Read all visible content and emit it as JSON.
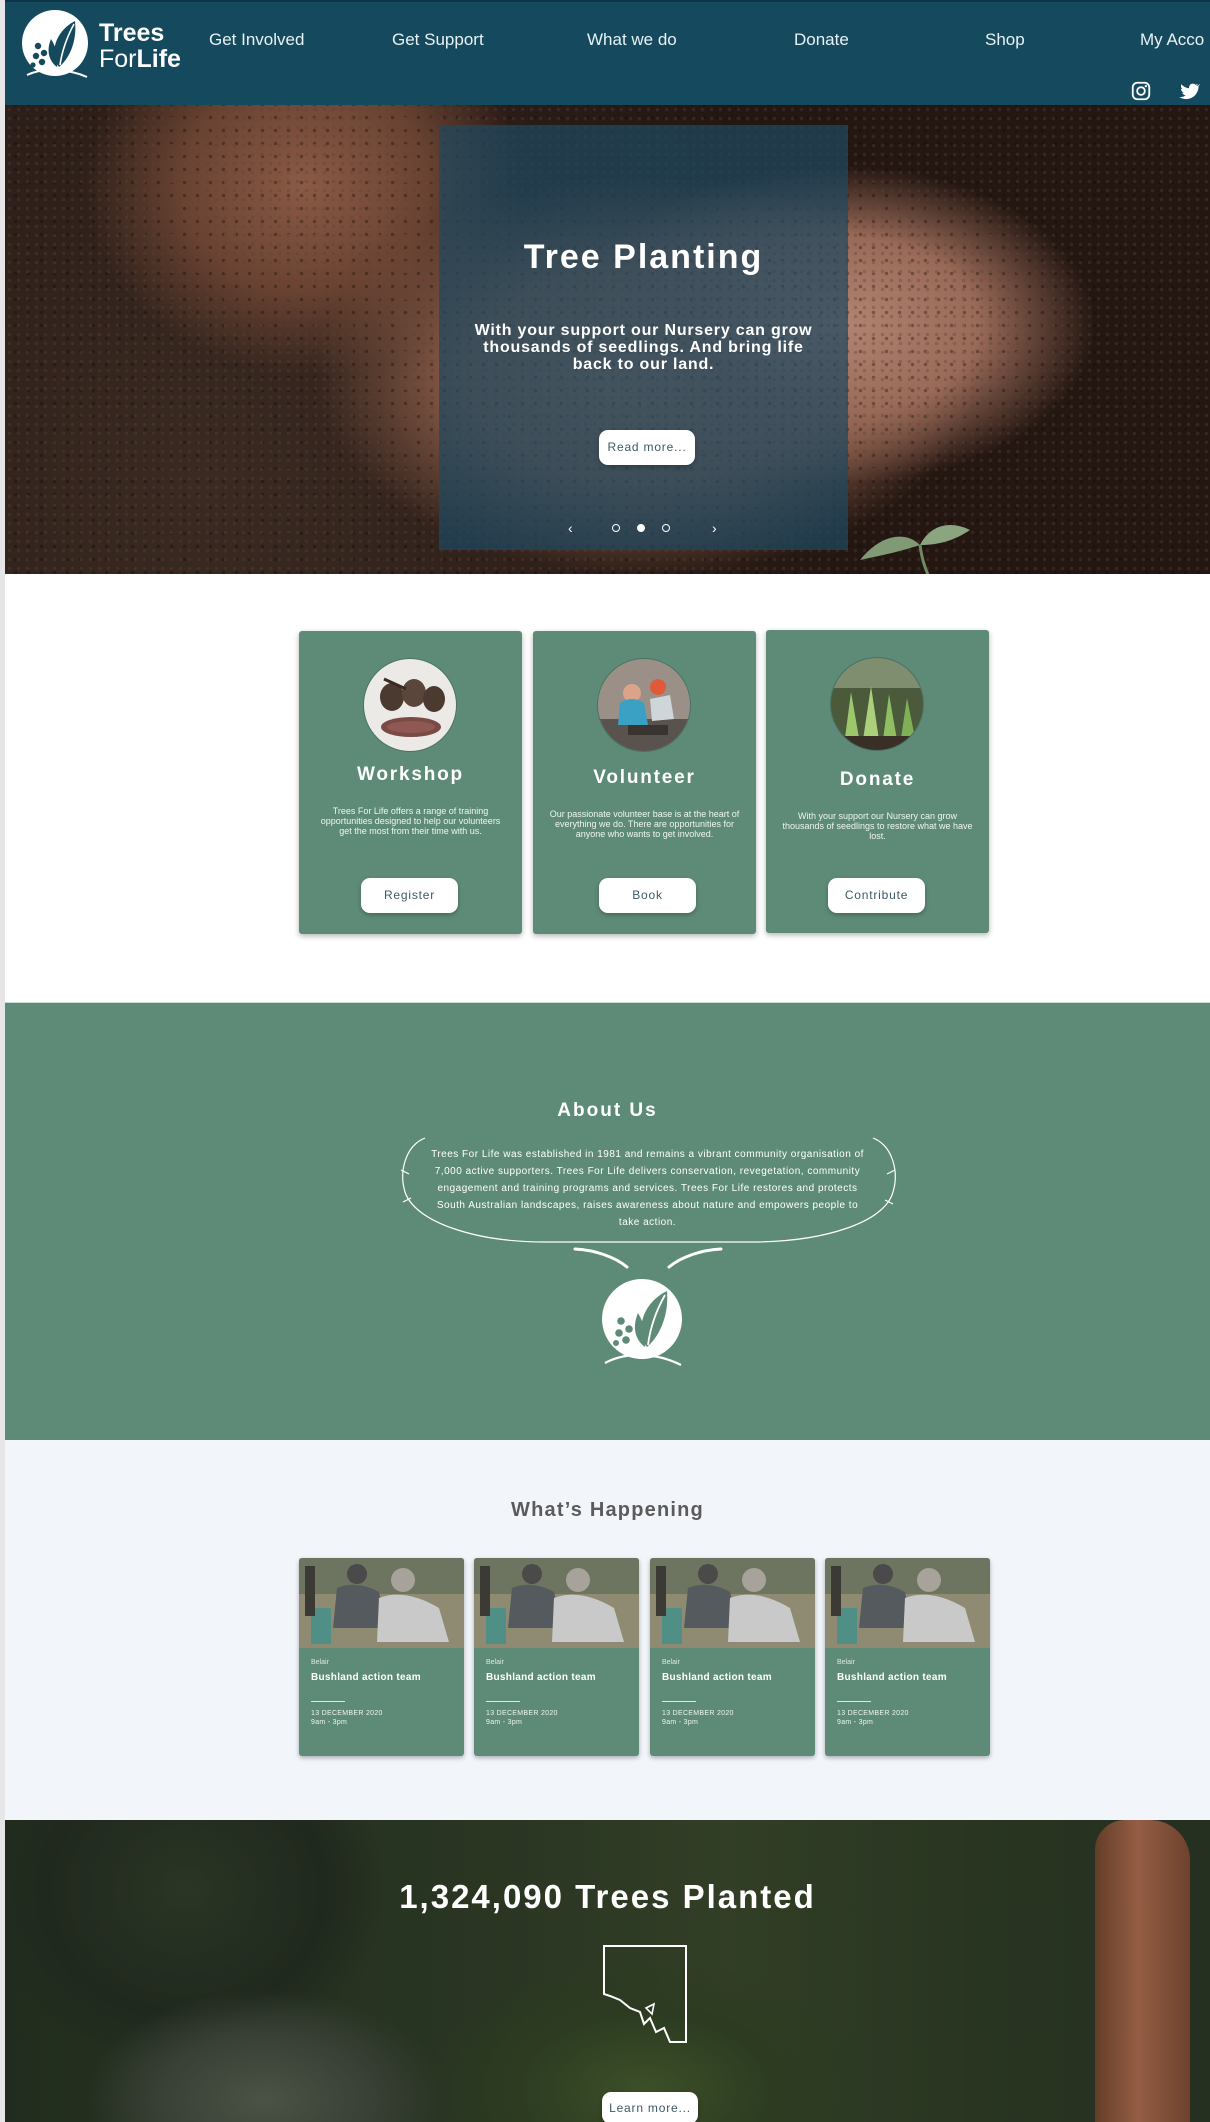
{
  "header": {
    "logo_line1": "Trees",
    "logo_line2_a": "For",
    "logo_line2_b": "Life",
    "nav": [
      "Get Involved",
      "Get Support",
      "What we do",
      "Donate",
      "Shop",
      "My Acco"
    ],
    "social": [
      "instagram-icon",
      "twitter-icon"
    ],
    "background": "#154a5e"
  },
  "hero": {
    "title": "Tree Planting",
    "subtitle": "With your support our Nursery can grow thousands of seedlings. And bring life back to our land.",
    "button": "Read more...",
    "prev_arrow": "‹",
    "next_arrow": "›",
    "slide_count": 3,
    "active_slide": 2
  },
  "features": [
    {
      "title": "Workshop",
      "text": "Trees For Life offers a range of training opportunities designed to help our volunteers get the most from their time with us.",
      "button": "Register"
    },
    {
      "title": "Volunteer",
      "text": "Our passionate volunteer base is at the heart of everything we do. There are opportunities for anyone who wants to get involved.",
      "button": "Book"
    },
    {
      "title": "Donate",
      "text": "With your support our Nursery can grow thousands of seedlings to restore what we have lost.",
      "button": "Contribute"
    }
  ],
  "about": {
    "title": "About Us",
    "text": "Trees For Life was established in 1981 and remains a vibrant community organisation of 7,000 active supporters. Trees For Life delivers conservation, revegetation, community engagement and training programs and services. Trees For Life restores and protects South Australian landscapes, raises awareness about nature and empowers people to take action."
  },
  "happening": {
    "title": "What’s Happening",
    "events": [
      {
        "location": "Belair",
        "name": "Bushland action team",
        "date": "13 DECEMBER 2020",
        "time": "9am - 3pm"
      },
      {
        "location": "Belair",
        "name": "Bushland action team",
        "date": "13 DECEMBER 2020",
        "time": "9am - 3pm"
      },
      {
        "location": "Belair",
        "name": "Bushland action team",
        "date": "13 DECEMBER 2020",
        "time": "9am - 3pm"
      },
      {
        "location": "Belair",
        "name": "Bushland action team",
        "date": "13 DECEMBER 2020",
        "time": "9am - 3pm"
      }
    ]
  },
  "trees": {
    "title": "1,324,090 Trees Planted",
    "button": "Learn more..."
  },
  "colors": {
    "primary_teal": "#154a5e",
    "card_green": "#5e8b78",
    "section_bg": "#f2f6fb"
  }
}
